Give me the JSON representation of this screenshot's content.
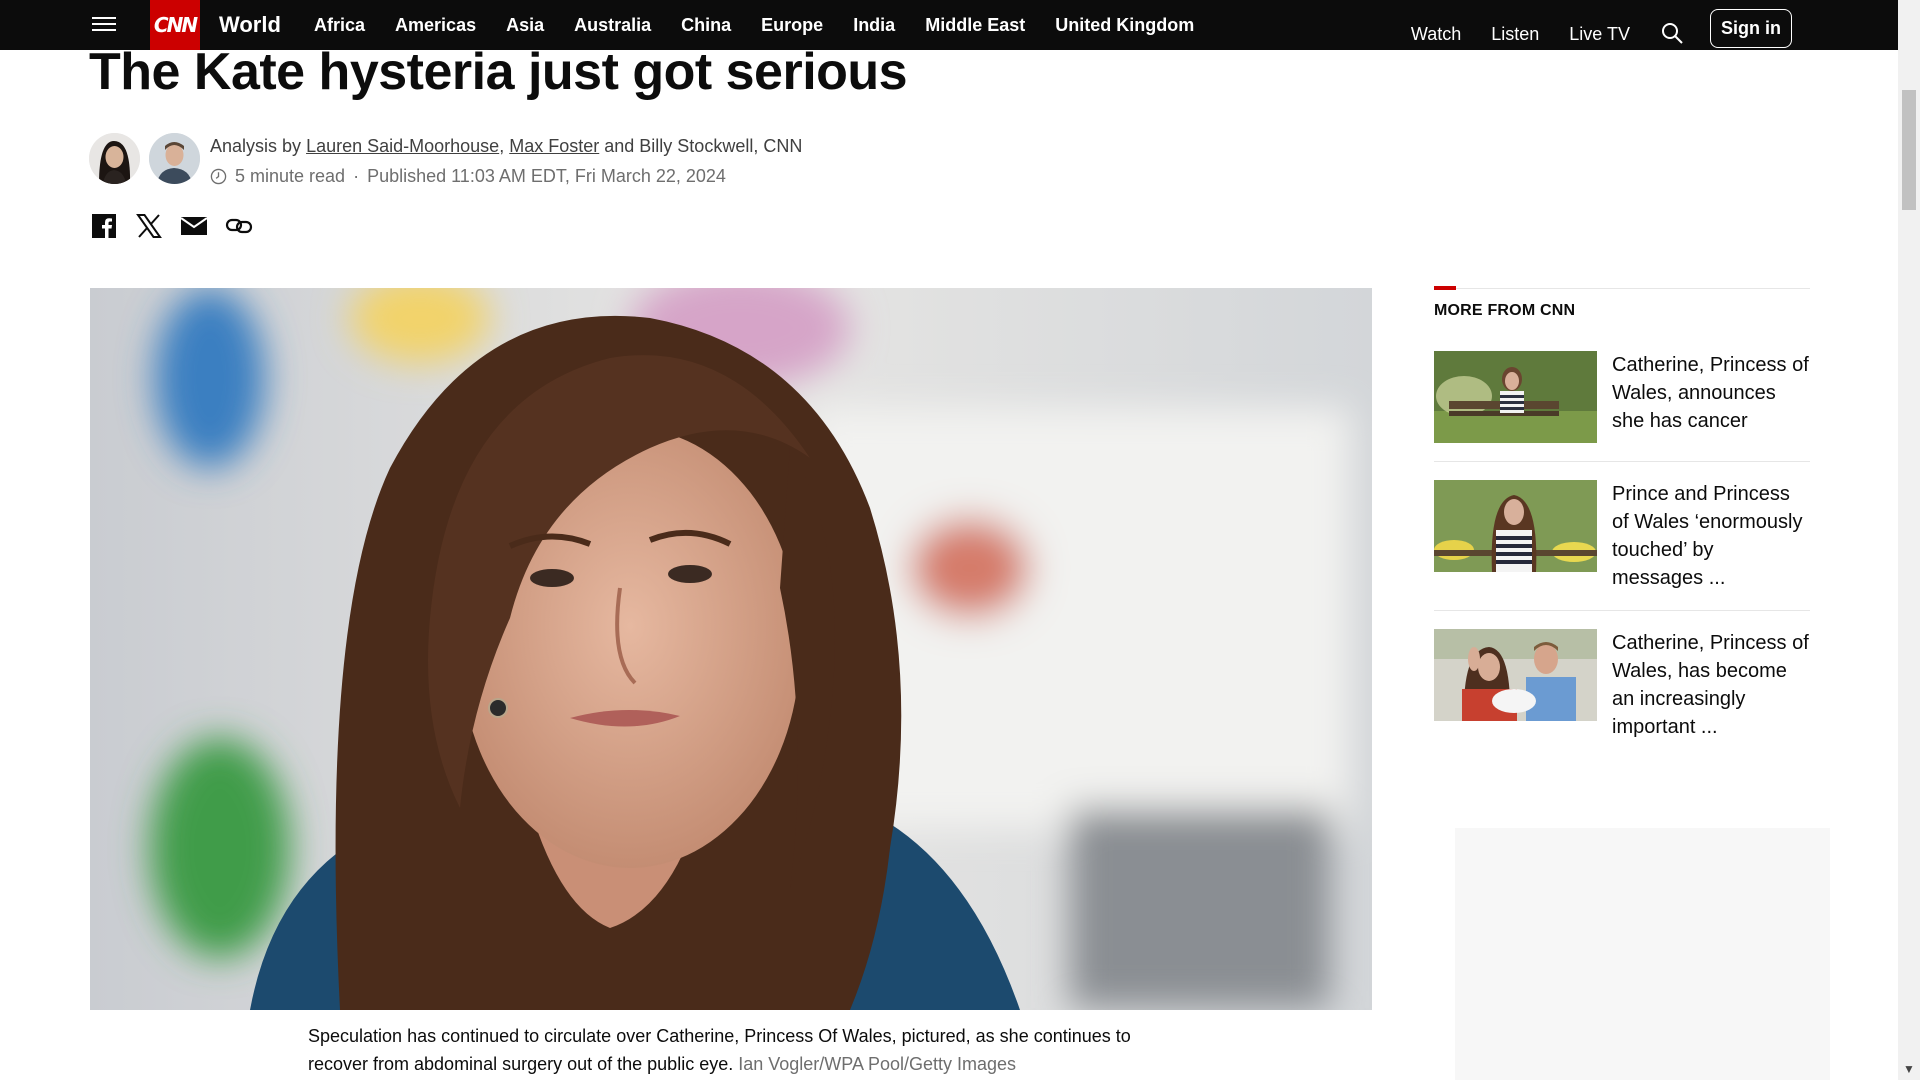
{
  "nav": {
    "section": "World",
    "links": [
      "Africa",
      "Americas",
      "Asia",
      "Australia",
      "China",
      "Europe",
      "India",
      "Middle East",
      "United Kingdom"
    ],
    "right": [
      "Watch",
      "Listen",
      "Live TV"
    ],
    "signin": "Sign in",
    "logo_text": "CNN"
  },
  "article": {
    "headline": "The Kate hysteria just got serious",
    "byline_prefix": "Analysis by",
    "author1": "Lauren Said-Moorhouse",
    "author2": "Max Foster",
    "byline_rest": "and Billy Stockwell, CNN",
    "read_time": "5 minute read",
    "published": "Published 11:03 AM EDT, Fri March 22, 2024",
    "caption_text": "Speculation has continued to circulate over Catherine, Princess Of Wales, pictured, as she continues to recover from abdominal surgery out of the public eye.",
    "caption_credit": "Ian Vogler/WPA Pool/Getty Images"
  },
  "sidebar": {
    "title": "MORE FROM CNN",
    "stories": [
      {
        "title": "Catherine, Princess of Wales, announces she has cancer"
      },
      {
        "title": "Prince and Princess of Wales ‘enormously touched’ by messages ..."
      },
      {
        "title": "Catherine, Princess of Wales, has become an increasingly important ..."
      }
    ]
  },
  "colors": {
    "nav_bg": "#0c0c0c",
    "brand_red": "#cc0000",
    "text": "#0c0c0c",
    "muted": "#6e6e6e"
  },
  "icons": [
    "menu-icon",
    "search-icon",
    "clock-icon",
    "facebook-icon",
    "x-icon",
    "email-icon",
    "link-icon"
  ]
}
